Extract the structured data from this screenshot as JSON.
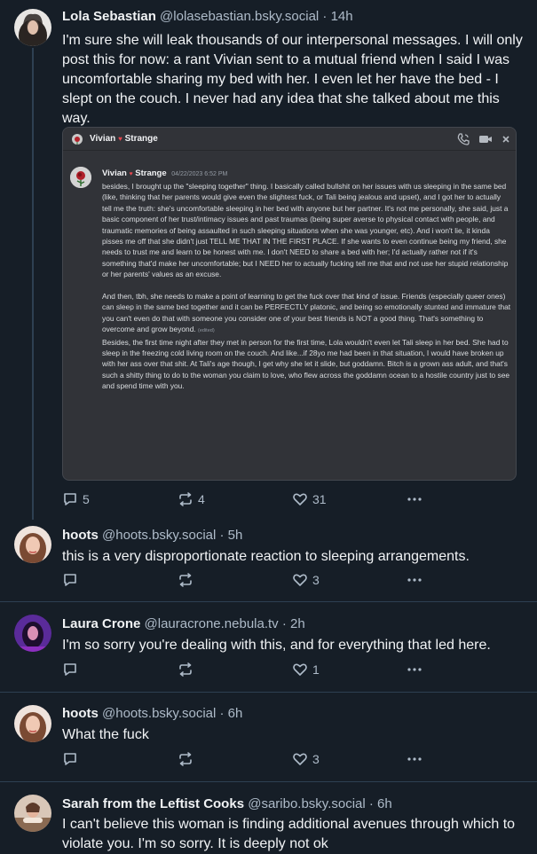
{
  "posts": [
    {
      "name": "Lola Sebastian",
      "handle": "@lolasebastian.bsky.social",
      "time": "· 14h",
      "text": "I'm sure she will leak thousands of our interpersonal messages. I will only post this for now: a rant Vivian sent to a mutual friend when I said I was uncomfortable sharing my bed with her. I even let her have the bed - I slept on the couch. I never had any idea that she talked about me this way.",
      "replies": "5",
      "reposts": "4",
      "likes": "31"
    },
    {
      "name": "hoots",
      "handle": "@hoots.bsky.social",
      "time": "· 5h",
      "text": "this is a very disproportionate reaction to sleeping arrangements.",
      "replies": "",
      "reposts": "",
      "likes": "3"
    },
    {
      "name": "Laura Crone",
      "handle": "@lauracrone.nebula.tv",
      "time": "· 2h",
      "text": "I'm so sorry you're dealing with this, and for everything that led here.",
      "replies": "",
      "reposts": "",
      "likes": "1"
    },
    {
      "name": "hoots",
      "handle": "@hoots.bsky.social",
      "time": "· 6h",
      "text": "What the fuck",
      "replies": "",
      "reposts": "",
      "likes": "3"
    },
    {
      "name": "Sarah from the Leftist Cooks",
      "handle": "@saribo.bsky.social",
      "time": "· 6h",
      "text": "I can't believe this woman is finding additional avenues through which to violate you. I'm so sorry. It is deeply not ok",
      "replies": "",
      "reposts": "",
      "likes": ""
    }
  ],
  "embed": {
    "channel_name": "Vivian",
    "channel_surname": "Strange",
    "heart": "♥",
    "msg_user": "Vivian",
    "msg_user_surname": "Strange",
    "msg_timestamp": "04/22/2023 6:52 PM",
    "para1": "besides, I brought up the \"sleeping together\" thing. I basically called bullshit on her issues with us sleeping in the same bed (like, thinking that her parents would give even the slightest fuck, or Tali being jealous and upset), and I got her to actually tell me the truth: she's uncomfortable sleeping in her bed with anyone but her partner. It's not me personally, she said, just a basic component of her trust/intimacy issues and past traumas (being super averse to physical contact with people, and traumatic memories of being assaulted in such sleeping situations when she was younger, etc). And i won't lie, it kinda pisses me off that she didn't just TELL ME THAT IN THE FIRST PLACE. If she wants to even continue being my friend, she needs to trust me and learn to be honest with me. I don't NEED to share a bed with her; I'd actually rather not if it's something that'd make her uncomfortable; but I NEED her to actually fucking tell me that and not use her stupid relationship or her parents' values as an excuse.",
    "para2": "And then, tbh, she needs to make a point of learning to get the fuck over that kind of issue. Friends (especially queer ones) can sleep in the same bed together and it can be PERFECTLY platonic, and being so emotionally stunted and immature that you can't even do that with someone you consider one of your best friends is NOT a good thing. That's something to overcome and grow beyond.",
    "edited": "(edited)",
    "para3": "Besides, the first time night after they met in person for the first time, Lola wouldn't even let Tali sleep in her bed. She had to sleep in the freezing cold living room on the couch. And like...if 28yo me had been in that situation, I would have broken up with her ass over that shit. At Tali's age though, I get why she let it slide, but goddamn. Bitch is a grown ass adult, and that's such a shitty thing to do to the woman you claim to love, who flew across the goddamn ocean to a hostile country just to see and spend time with you."
  },
  "icons": {
    "reply": "reply-icon",
    "repost": "repost-icon",
    "like": "heart-icon",
    "more": "more-icon",
    "call": "phone-icon",
    "video": "video-icon",
    "close": "close-icon"
  },
  "colors": {
    "background": "#161e27",
    "text": "#f1f3f5",
    "muted": "#aebbc9",
    "divider": "#2e4052",
    "embed_background": "#313338",
    "discord_heart": "#e5474f"
  }
}
